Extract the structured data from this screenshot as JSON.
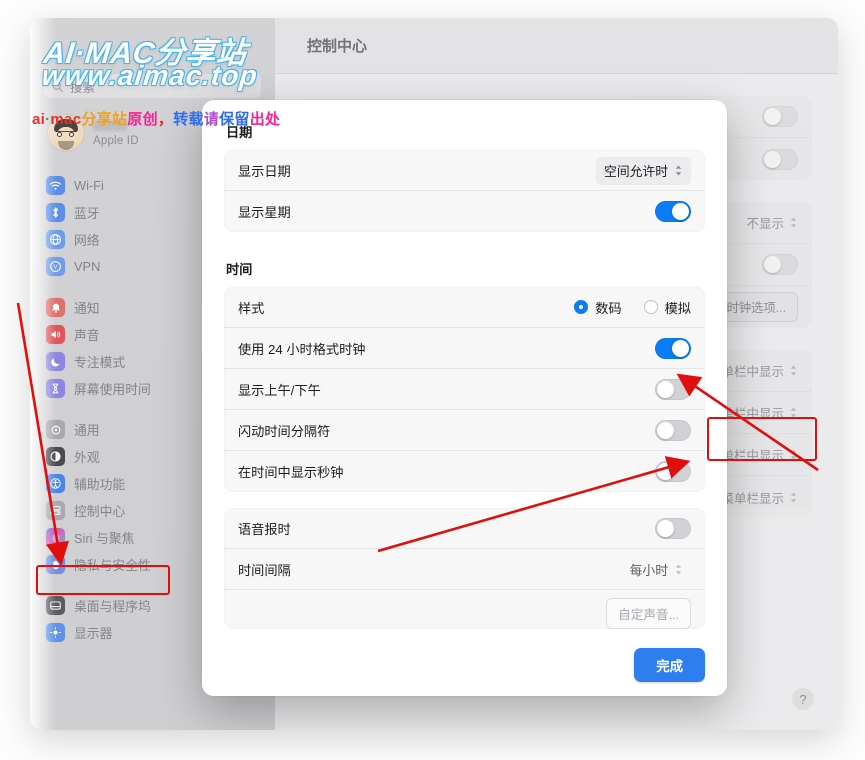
{
  "window": {
    "sidebar": {
      "search": {
        "placeholder": "搜索",
        "icon": "search-icon"
      },
      "account": {
        "name_redacted": "",
        "subtitle": "Apple ID"
      },
      "groups": [
        {
          "items": [
            {
              "label": "Wi-Fi",
              "icon": "wifi-icon",
              "color": "#5a8ee8"
            },
            {
              "label": "蓝牙",
              "icon": "bluetooth-icon",
              "color": "#5a8ee8"
            },
            {
              "label": "网络",
              "icon": "globe-icon",
              "color": "#6f9bea"
            },
            {
              "label": "VPN",
              "icon": "vpn-globe-icon",
              "color": "#6f9bea"
            }
          ]
        },
        {
          "items": [
            {
              "label": "通知",
              "icon": "bell-icon",
              "color": "#e0706c"
            },
            {
              "label": "声音",
              "icon": "speaker-icon",
              "color": "#e0555a"
            },
            {
              "label": "专注模式",
              "icon": "moon-icon",
              "color": "#8d86e0"
            },
            {
              "label": "屏幕使用时间",
              "icon": "hourglass-icon",
              "color": "#8d86e0"
            }
          ]
        },
        {
          "items": [
            {
              "label": "通用",
              "icon": "gear-icon",
              "color": "#a8a8ae"
            },
            {
              "label": "外观",
              "icon": "appearance-icon",
              "color": "#4a4a4f"
            },
            {
              "label": "辅助功能",
              "icon": "accessibility-icon",
              "color": "#4a86e8"
            },
            {
              "label": "控制中心",
              "icon": "control-center-icon",
              "color": "#a8a8ae",
              "selected": true
            },
            {
              "label": "Siri 与聚焦",
              "icon": "siri-icon",
              "color": "#8b6fd6"
            },
            {
              "label": "隐私与安全性",
              "icon": "privacy-hand-icon",
              "color": "#6f8fe0"
            }
          ]
        },
        {
          "items": [
            {
              "label": "桌面与程序坞",
              "icon": "desktop-dock-icon",
              "color": "#5a5a60"
            },
            {
              "label": "显示器",
              "icon": "display-icon",
              "color": "#5f91e8"
            }
          ]
        }
      ]
    },
    "content": {
      "title": "控制中心",
      "background_rows": [
        {
          "type": "toggle",
          "state": "off"
        },
        {
          "type": "toggle",
          "state": "off"
        },
        {
          "type": "popup",
          "value": "不显示"
        },
        {
          "type": "toggle",
          "state": "off"
        },
        {
          "type": "button",
          "label": "时钟选项..."
        },
        {
          "type": "popup",
          "value": "在菜单栏中显示"
        },
        {
          "type": "popup",
          "value": "在菜单栏中显示"
        },
        {
          "type": "popup",
          "value": "在菜单栏中显示"
        },
        {
          "type": "popup",
          "value": "在菜单栏显示"
        }
      ],
      "help_label": "?"
    }
  },
  "sheet": {
    "sections": [
      {
        "title": "日期",
        "rows": [
          {
            "label": "显示日期",
            "control": "popup",
            "value": "空间允许时"
          },
          {
            "label": "显示星期",
            "control": "toggle",
            "state": "on"
          }
        ]
      },
      {
        "title": "时间",
        "rows": [
          {
            "label": "样式",
            "control": "radio",
            "options": [
              "数码",
              "模拟"
            ],
            "selected": "数码"
          },
          {
            "label": "使用 24 小时格式时钟",
            "control": "toggle",
            "state": "on"
          },
          {
            "label": "显示上午/下午",
            "control": "toggle",
            "state": "off"
          },
          {
            "label": "闪动时间分隔符",
            "control": "toggle",
            "state": "off"
          },
          {
            "label": "在时间中显示秒钟",
            "control": "toggle",
            "state": "off"
          }
        ]
      },
      {
        "title": "",
        "rows": [
          {
            "label": "语音报时",
            "control": "toggle",
            "state": "off"
          },
          {
            "label": "时间间隔",
            "control": "popup",
            "value": "每小时"
          }
        ],
        "custom_button": "自定声音..."
      }
    ],
    "done_label": "完成"
  },
  "watermark": {
    "line1": "AI·MAC分享站",
    "line2": "www.aimac.top",
    "line3_parts": [
      "ai",
      "·",
      "mac",
      "分享站",
      "原创",
      "，",
      "转载",
      "请",
      "保留",
      "出处"
    ]
  },
  "annotations": {
    "accent_color": "#e10e0e",
    "highlight_sidebar_item": "控制中心",
    "highlight_button": "时钟选项..."
  }
}
